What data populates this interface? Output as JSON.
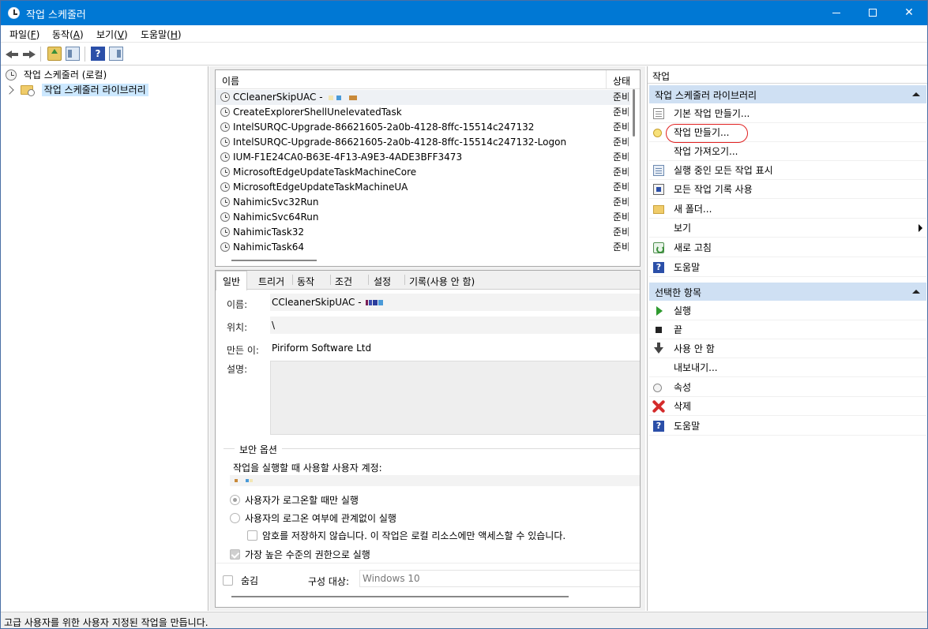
{
  "window": {
    "title": "작업 스케줄러",
    "minimize": "",
    "maximize": "",
    "close": "✕"
  },
  "menu": [
    {
      "label": "파일(",
      "key": "F",
      "end": ")"
    },
    {
      "label": "동작(",
      "key": "A",
      "end": ")"
    },
    {
      "label": "보기(",
      "key": "V",
      "end": ")"
    },
    {
      "label": "도움말(",
      "key": "H",
      "end": ")"
    }
  ],
  "toolbar": {
    "help_glyph": "?"
  },
  "tree": {
    "root": "작업 스케줄러 (로컬)",
    "library": "작업 스케줄러 라이브러리"
  },
  "task_list": {
    "col_name": "이름",
    "col_status": "상태",
    "rows": [
      {
        "name": "CCleanerSkipUAC - ",
        "status": "준비"
      },
      {
        "name": "CreateExplorerShellUnelevatedTask",
        "status": "준비"
      },
      {
        "name": "IntelSURQC-Upgrade-86621605-2a0b-4128-8ffc-15514c247132",
        "status": "준비"
      },
      {
        "name": "IntelSURQC-Upgrade-86621605-2a0b-4128-8ffc-15514c247132-Logon",
        "status": "준비"
      },
      {
        "name": "IUM-F1E24CA0-B63E-4F13-A9E3-4ADE3BFF3473",
        "status": "준비"
      },
      {
        "name": "MicrosoftEdgeUpdateTaskMachineCore",
        "status": "준비"
      },
      {
        "name": "MicrosoftEdgeUpdateTaskMachineUA",
        "status": "준비"
      },
      {
        "name": "NahimicSvc32Run",
        "status": "준비"
      },
      {
        "name": "NahimicSvc64Run",
        "status": "준비"
      },
      {
        "name": "NahimicTask32",
        "status": "준비"
      },
      {
        "name": "NahimicTask64",
        "status": "준비"
      }
    ]
  },
  "details": {
    "tabs": [
      "일반",
      "트리거",
      "동작",
      "조건",
      "설정",
      "기록(사용 안 함)"
    ],
    "name_label": "이름:",
    "name_value": "CCleanerSkipUAC - ",
    "location_label": "위치:",
    "location_value": "\\",
    "author_label": "만든 이:",
    "author_value": "Piriform Software Ltd",
    "desc_label": "설명:",
    "security_title": "보안 옵션",
    "account_prompt": "작업을 실행할 때 사용할 사용자 계정:",
    "opt_logged_on": "사용자가 로그온할 때만 실행",
    "opt_always": "사용자의 로그온 여부에 관계없이 실행",
    "opt_no_password": "암호를 저장하지 않습니다. 이 작업은 로컬 리소스에만 액세스할 수 있습니다.",
    "opt_highest": "가장 높은 수준의 권한으로 실행",
    "hidden_label": "숨김",
    "config_label": "구성 대상:",
    "config_value": "Windows 10"
  },
  "actions": {
    "header": "작업",
    "section1": "작업 스케줄러 라이브러리",
    "items1": [
      {
        "label": "기본 작업 만들기...",
        "icon": "doc"
      },
      {
        "label": "작업 만들기...",
        "icon": "newtask"
      },
      {
        "label": "작업 가져오기...",
        "icon": ""
      },
      {
        "label": "실행 중인 모든 작업 표시",
        "icon": "list"
      },
      {
        "label": "모든 작업 기록 사용",
        "icon": "hist"
      },
      {
        "label": "새 폴더...",
        "icon": "folder"
      },
      {
        "label": "보기",
        "icon": ""
      },
      {
        "label": "새로 고침",
        "icon": "refresh"
      },
      {
        "label": "도움말",
        "icon": "help"
      }
    ],
    "section2": "선택한 항목",
    "items2": [
      {
        "label": "실행",
        "icon": "play"
      },
      {
        "label": "끝",
        "icon": "stop"
      },
      {
        "label": "사용 안 함",
        "icon": "down"
      },
      {
        "label": "내보내기...",
        "icon": ""
      },
      {
        "label": "속성",
        "icon": "props"
      },
      {
        "label": "삭제",
        "icon": "del"
      },
      {
        "label": "도움말",
        "icon": "help"
      }
    ],
    "help_glyph": "?"
  },
  "status": "고급 사용자를 위한 사용자 지정된 작업을 만듭니다."
}
